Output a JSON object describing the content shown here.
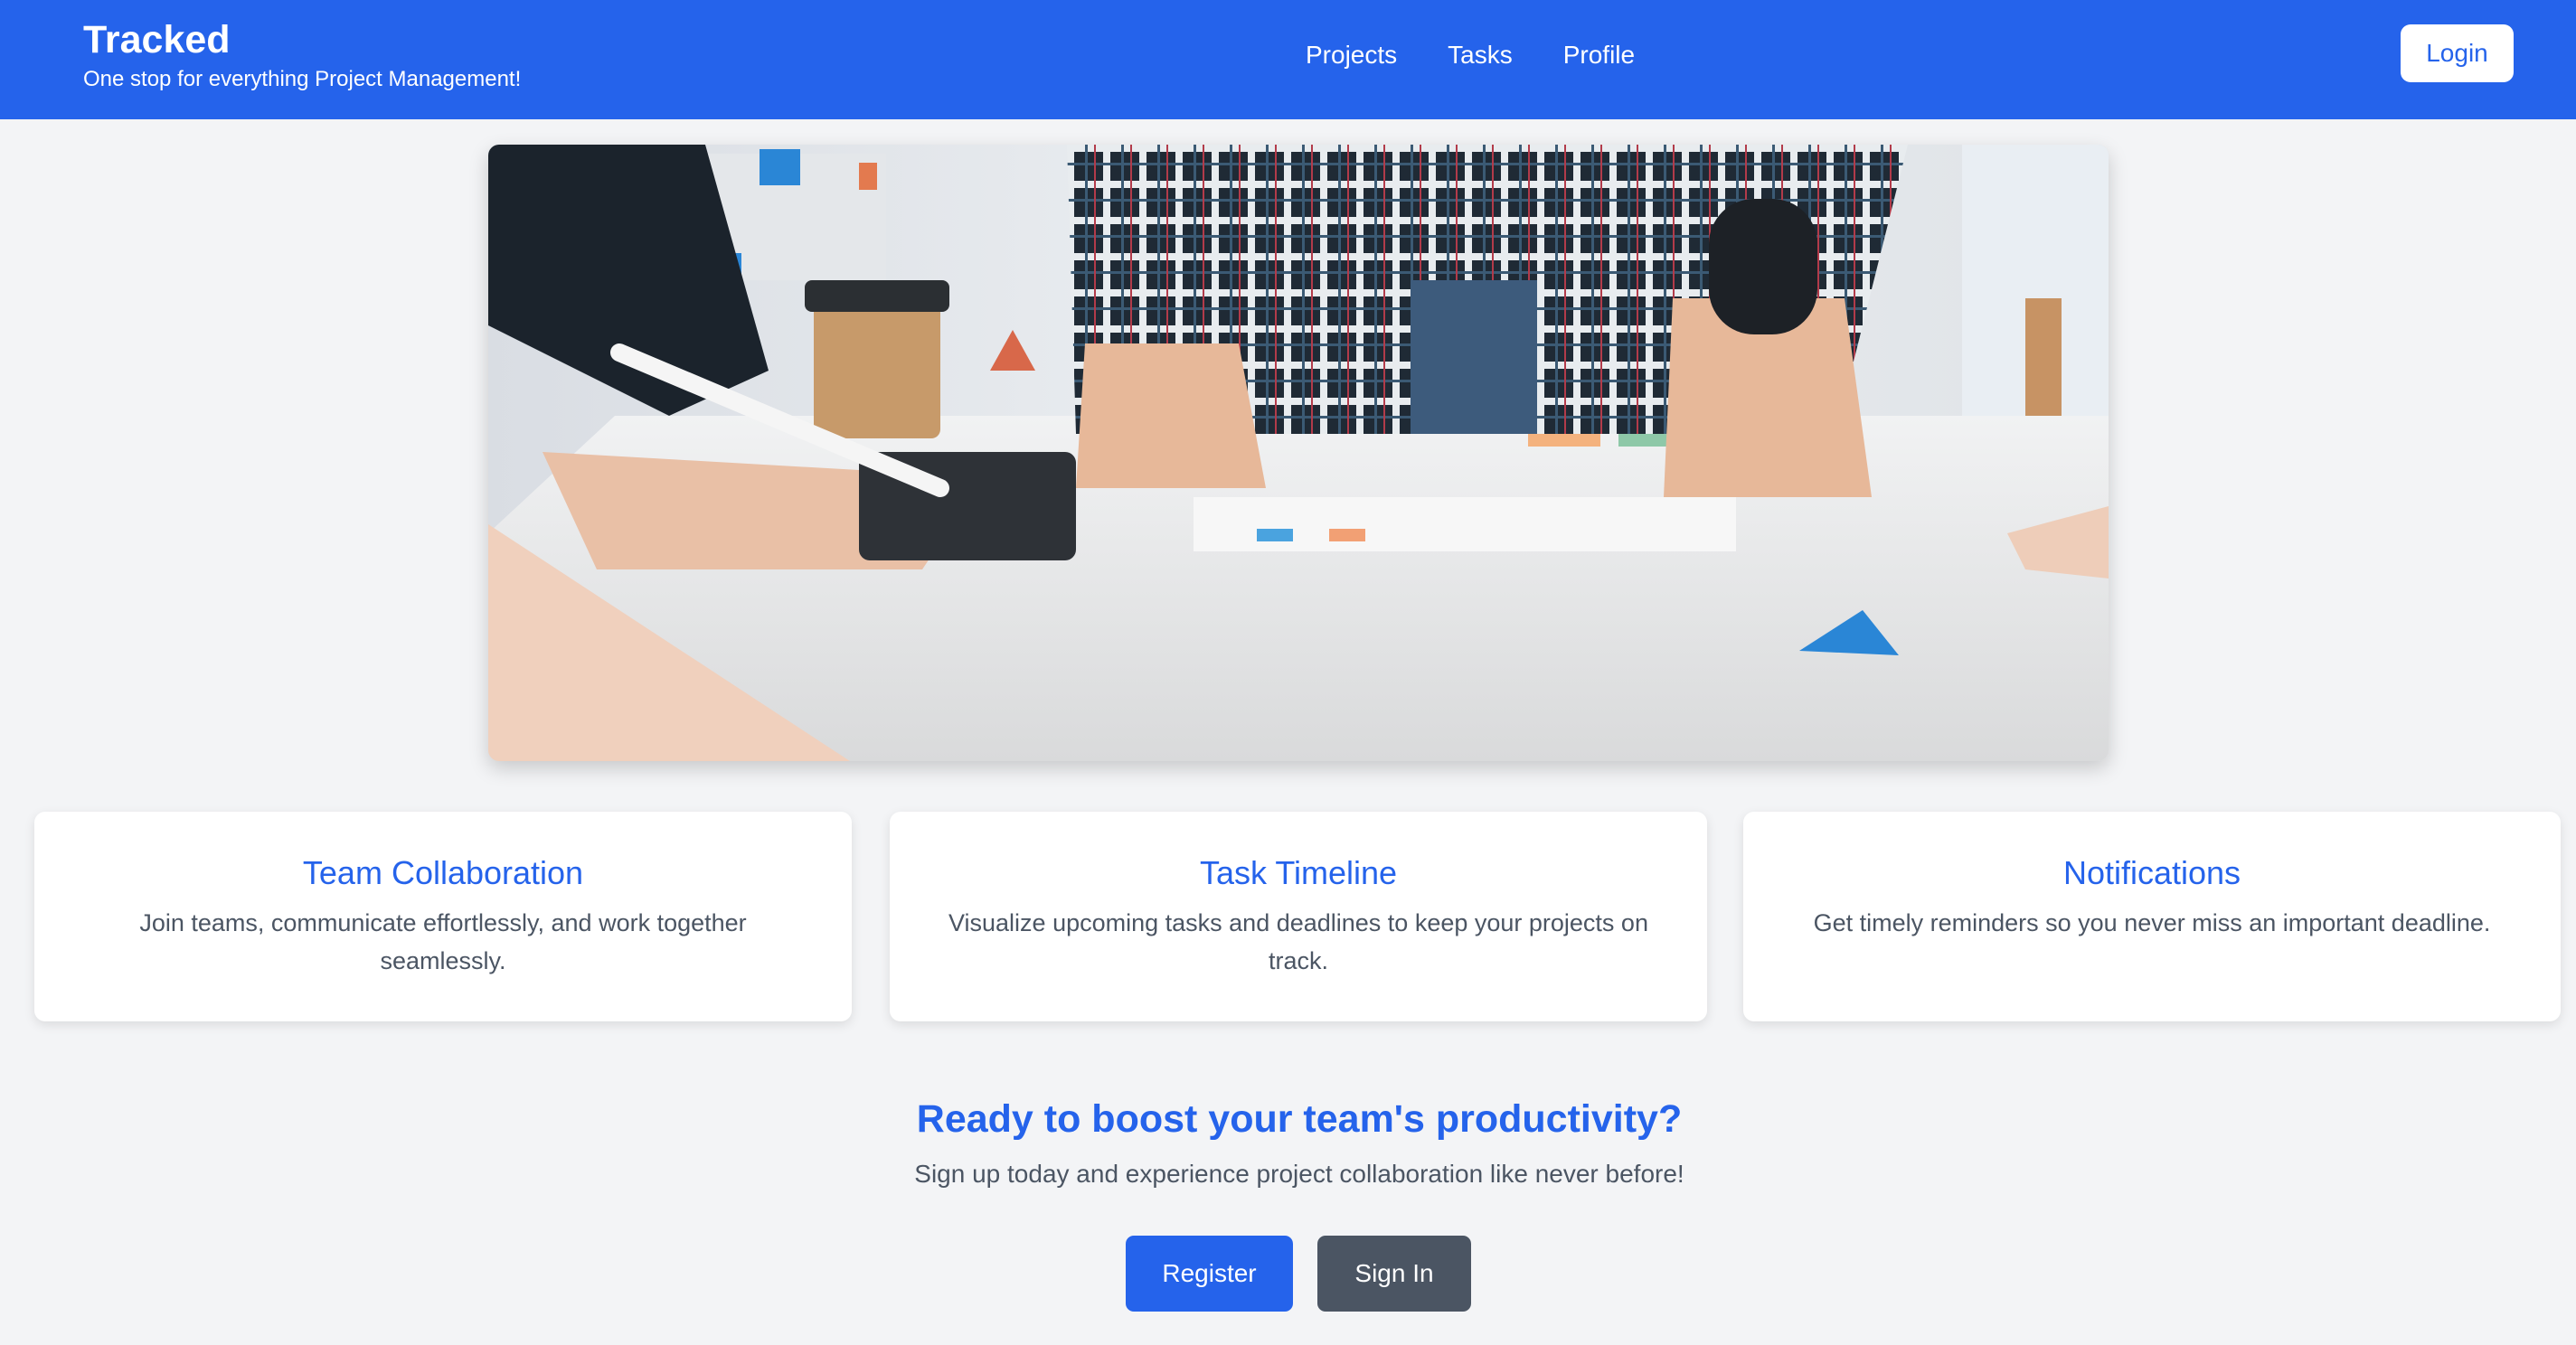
{
  "header": {
    "brand_title": "Tracked",
    "brand_tagline": "One stop for everything Project Management!",
    "nav": [
      "Projects",
      "Tasks",
      "Profile"
    ],
    "login_label": "Login"
  },
  "hero": {
    "image": "team-meeting-desk-photo"
  },
  "features": [
    {
      "title": "Team Collaboration",
      "text": "Join teams, communicate effortlessly, and work together seamlessly."
    },
    {
      "title": "Task Timeline",
      "text": "Visualize upcoming tasks and deadlines to keep your projects on track."
    },
    {
      "title": "Notifications",
      "text": "Get timely reminders so you never miss an important deadline."
    }
  ],
  "cta": {
    "title": "Ready to boost your team's productivity?",
    "subtitle": "Sign up today and experience project collaboration like never before!",
    "register_label": "Register",
    "signin_label": "Sign In"
  },
  "colors": {
    "primary": "#2563eb",
    "secondary": "#4b5563",
    "background": "#f3f4f6"
  }
}
